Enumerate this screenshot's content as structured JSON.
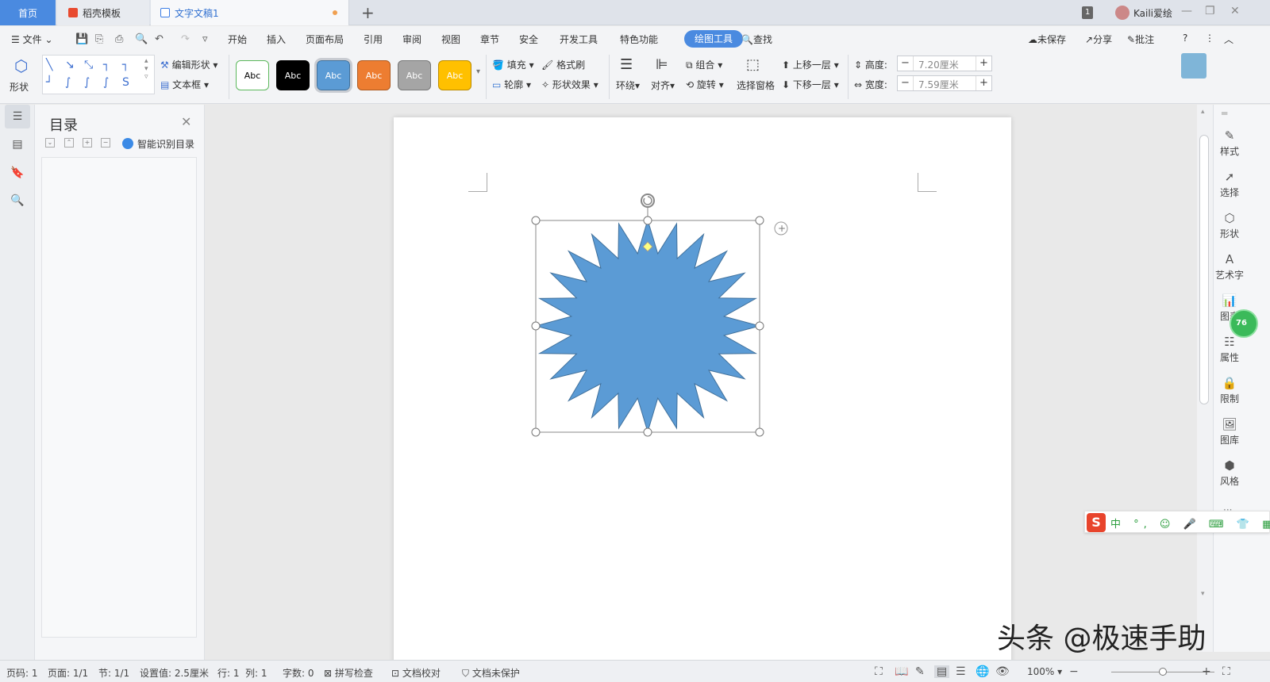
{
  "tabs": {
    "home": "首页",
    "template": "稻壳模板",
    "doc": "文字文稿1",
    "add": "+"
  },
  "titlebar": {
    "window_count": "1",
    "user": "Kaili爱绘",
    "minimize": "—",
    "restore": "❐",
    "close": "✕"
  },
  "menu": {
    "file": "文件",
    "items": [
      "开始",
      "插入",
      "页面布局",
      "引用",
      "审阅",
      "视图",
      "章节",
      "安全",
      "开发工具",
      "特色功能"
    ],
    "active": "绘图工具",
    "search": "查找",
    "unsaved": "未保存",
    "share": "分享",
    "comment": "批注"
  },
  "ribbon": {
    "shape": "形状",
    "edit_shape": "编辑形状",
    "textbox": "文本框",
    "styles": [
      {
        "label": "Abc",
        "bg": "#ffffff",
        "fg": "#000000",
        "border": "#5cb85c"
      },
      {
        "label": "Abc",
        "bg": "#000000",
        "fg": "#ffffff",
        "border": "#000000"
      },
      {
        "label": "Abc",
        "bg": "#5b9bd5",
        "fg": "#ffffff",
        "border": "#41719c"
      },
      {
        "label": "Abc",
        "bg": "#ed7d31",
        "fg": "#ffffff",
        "border": "#ae5a21"
      },
      {
        "label": "Abc",
        "bg": "#a5a5a5",
        "fg": "#ffffff",
        "border": "#787878"
      },
      {
        "label": "Abc",
        "bg": "#ffc000",
        "fg": "#ffffff",
        "border": "#bc8c00"
      }
    ],
    "fill": "填充",
    "outline": "轮廓",
    "format_brush": "格式刷",
    "shape_effect": "形状效果",
    "wrap": "环绕",
    "align": "对齐",
    "group": "组合",
    "rotate": "旋转",
    "selection_pane": "选择窗格",
    "bring_forward": "上移一层",
    "send_backward": "下移一层",
    "height_label": "高度:",
    "height_value": "7.20厘米",
    "width_label": "宽度:",
    "width_value": "7.59厘米"
  },
  "toc": {
    "title": "目录",
    "smart": "智能识别目录"
  },
  "sidebar": {
    "items": [
      "样式",
      "选择",
      "形状",
      "艺术字",
      "图表",
      "属性",
      "限制",
      "图库",
      "风格"
    ],
    "badge": "76"
  },
  "shape": {
    "fill_color": "#5b9bd5",
    "stroke_color": "#41719c"
  },
  "ime": {
    "logo": "S",
    "icons": "中 °, ☺ 🎤 ⌨ 👕 ▦"
  },
  "watermark": "头条 @极速手助",
  "status": {
    "page_num": "页码: 1",
    "pages": "页面: 1/1",
    "section": "节: 1/1",
    "setting": "设置值: 2.5厘米",
    "row": "行: 1",
    "col": "列: 1",
    "words": "字数: 0",
    "spell": "拼写检查",
    "proof": "文档校对",
    "protect": "文档未保护",
    "zoom": "100%",
    "zoom_level": 0.5
  }
}
